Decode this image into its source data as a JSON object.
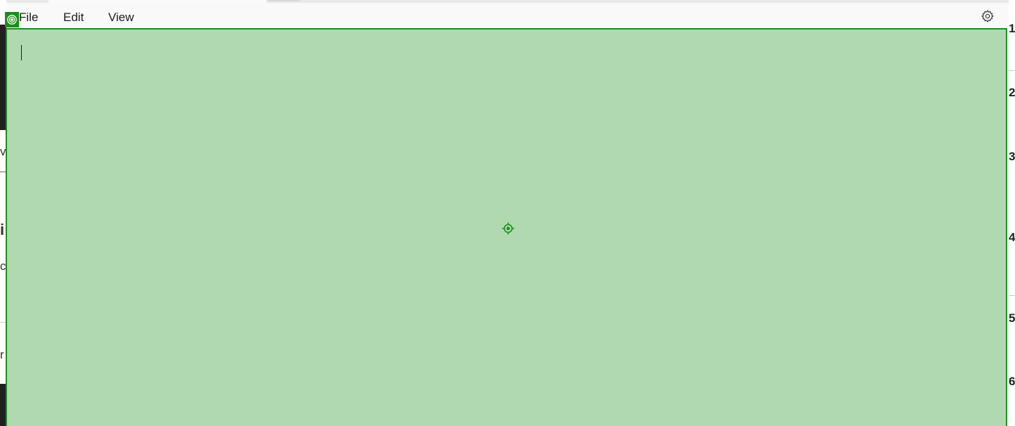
{
  "menu": {
    "file_label": "File",
    "edit_label": "Edit",
    "view_label": "View"
  },
  "toolbar": {
    "settings_icon": "gear-icon"
  },
  "editor": {
    "content": ""
  },
  "overlay": {
    "badge_icon": "target-icon",
    "center_marker_icon": "crosshair-icon",
    "highlight_color": "#1a8f1a",
    "highlight_fill": "#b0d9b0"
  },
  "background_windows": {
    "left_glyphs": [
      "v",
      "i",
      "c",
      "r"
    ],
    "right_glyphs": [
      "1",
      "2",
      "3",
      "4",
      "5",
      "6"
    ]
  }
}
